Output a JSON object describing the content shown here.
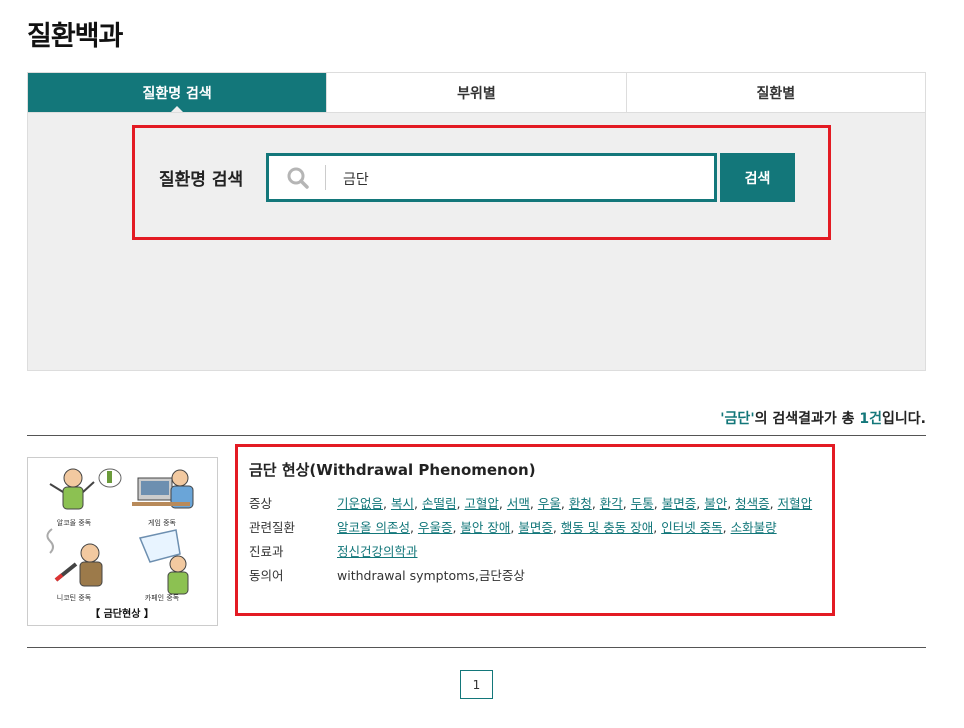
{
  "page_title": "질환백과",
  "tabs": [
    {
      "label": "질환명 검색",
      "active": true
    },
    {
      "label": "부위별",
      "active": false
    },
    {
      "label": "질환별",
      "active": false
    }
  ],
  "search": {
    "label": "질환명 검색",
    "value": "금단",
    "button_label": "검색"
  },
  "result_summary": {
    "quote_open": "'",
    "keyword": "금단",
    "quote_close": "'",
    "middle": "의 검색결과가 총 ",
    "count": "1건",
    "end": "입니다."
  },
  "result": {
    "title": "금단 현상(Withdrawal Phenomenon)",
    "image_caption": "【 금단현상 】",
    "image_panels": [
      "알코올 중독",
      "게임 중독",
      "니코틴 중독",
      "카페인 중독"
    ],
    "symptoms_label": "증상",
    "symptoms": [
      "기운없음",
      "복시",
      "손떨림",
      "고혈압",
      "서맥",
      "우울",
      "환청",
      "환각",
      "두통",
      "불면증",
      "불안",
      "청색증",
      "저혈압"
    ],
    "related_label": "관련질환",
    "related": [
      "알코올 의존성",
      "우울증",
      "불안 장애",
      "불면증",
      "행동 및 충동 장애",
      "인터넷 중독",
      "소화불량"
    ],
    "department_label": "진료과",
    "department": "정신건강의학과",
    "synonym_label": "동의어",
    "synonym": "withdrawal symptoms,금단증상"
  },
  "pagination": {
    "current": "1"
  },
  "colors": {
    "accent": "#13777a",
    "highlight": "#e31b23",
    "panel_bg": "#efefef"
  }
}
